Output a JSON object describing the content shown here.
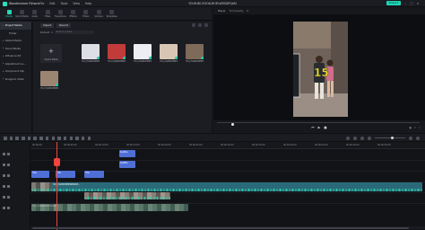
{
  "app": {
    "name": "Wondershare Filmora",
    "menu": [
      "File",
      "Edit",
      "Tools",
      "View",
      "Help"
    ],
    "document_title": "YOUR-BE-ROOK-MOM-WRSDPQAM",
    "export_label": "Export"
  },
  "media_tabs": [
    {
      "label": "Media",
      "icon": "media-icon",
      "active": true
    },
    {
      "label": "Stock Media",
      "icon": "stock-media-icon"
    },
    {
      "label": "Audio",
      "icon": "audio-icon"
    },
    {
      "label": "Titles",
      "icon": "titles-icon"
    },
    {
      "label": "Transitions",
      "icon": "transitions-icon"
    },
    {
      "label": "Effects",
      "icon": "effects-icon"
    },
    {
      "label": "Filters",
      "icon": "filters-icon"
    },
    {
      "label": "Stickers",
      "icon": "stickers-icon"
    },
    {
      "label": "Templates",
      "icon": "templates-icon"
    }
  ],
  "sidebar": {
    "items": [
      {
        "label": "Project Media",
        "active": true
      },
      {
        "label": "Folder",
        "sub": true
      },
      {
        "label": "Global Media"
      },
      {
        "label": "Cloud Media"
      },
      {
        "label": "Influence Kit"
      },
      {
        "label": "Adjustment La..."
      },
      {
        "label": "Compound Clip"
      },
      {
        "label": "Image to Video"
      }
    ]
  },
  "media_panel": {
    "import_label": "Import",
    "record_label": "Record",
    "folder_label": "Default",
    "search_placeholder": "Search media",
    "import_tile_label": "Import Media",
    "clips": [
      {
        "name": "YOU_HLWNXMMEDDBUPZ...",
        "color": "#dcdfe5"
      },
      {
        "name": "YOU_HLWNXMMEDDBUPZ...",
        "color": "#c13b3b"
      },
      {
        "name": "YOU_HLWNXMMEDDBUPZ...",
        "color": "#eceef2"
      },
      {
        "name": "YOU_HLWNXMMEDDBUPZ...",
        "color": "#d8c6b5"
      },
      {
        "name": "YOU_HLWNXMMEDDBUPZ...",
        "color": "#7e6a58"
      },
      {
        "name": "YOU_HLWNXMMEDDBUPZ...",
        "color": "#9b8572"
      }
    ]
  },
  "player": {
    "tab_label": "Player",
    "quality_label": "Full Quality",
    "overlay_number": "15"
  },
  "timeline": {
    "ruler_ticks": [
      "00:00:00",
      "00:00:05:00",
      "00:00:10:00",
      "00:00:15:00",
      "00:00:20:00",
      "00:00:25:00",
      "00:00:30:00",
      "00:00:35:00",
      "00:00:40:00",
      "00:00:45:00",
      "00:00:50:00",
      "00:00:55:00"
    ],
    "text_clips": [
      "Title",
      "Title",
      "Title",
      "Subtitle"
    ],
    "video_clip_label": "YOU_HLWNXMMEDDBUPZ...",
    "audio_clip_label": "YOU_HLWNXMMEDDBUPZ..."
  }
}
